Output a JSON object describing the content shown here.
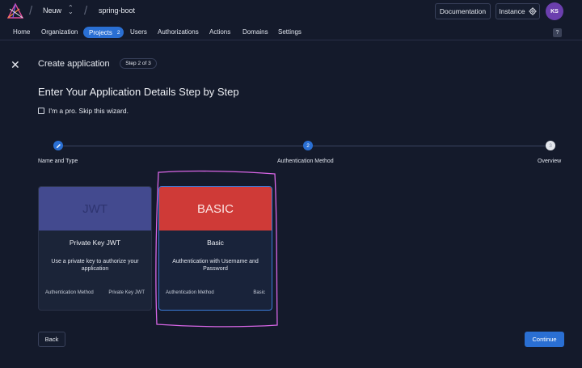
{
  "topbar": {
    "org_name": "Neuw",
    "org_switch_icon": "chevron-up-down-icon",
    "project_name": "spring-boot",
    "documentation_label": "Documentation",
    "instance_label": "Instance",
    "instance_icon": "gear-icon",
    "avatar_initials": "KS"
  },
  "nav": {
    "items": [
      "Home",
      "Organization",
      "Projects",
      "Users",
      "Authorizations",
      "Actions",
      "Domains",
      "Settings"
    ],
    "active": "Projects",
    "projects_count": "2",
    "help_label": "?"
  },
  "header": {
    "title": "Create application",
    "step_badge": "Step 2 of 3"
  },
  "wizard": {
    "heading": "Enter Your Application Details Step by Step",
    "skip_label": "I'm a pro. Skip this wizard.",
    "skip_checked": false,
    "steps": [
      {
        "label": "Name and Type",
        "state": "done",
        "icon": "pencil-icon",
        "number": ""
      },
      {
        "label": "Authentication Method",
        "state": "active",
        "icon": "",
        "number": "2"
      },
      {
        "label": "Overview",
        "state": "pending",
        "icon": "",
        "number": "3"
      }
    ]
  },
  "cards": [
    {
      "banner": "JWT",
      "title": "Private Key JWT",
      "description": "Use a private key to authorize your application",
      "meta_label": "Authentication Method",
      "meta_value": "Private Key JWT",
      "selected": false,
      "banner_color": "#434a8f"
    },
    {
      "banner": "BASIC",
      "title": "Basic",
      "description": "Authentication with Username and Password",
      "meta_label": "Authentication Method",
      "meta_value": "Basic",
      "selected": true,
      "banner_color": "#cf3a37"
    }
  ],
  "footer": {
    "back_label": "Back",
    "continue_label": "Continue"
  },
  "colors": {
    "background": "#141a2b",
    "accent": "#2a6fd3",
    "highlight": "#d866e6"
  }
}
